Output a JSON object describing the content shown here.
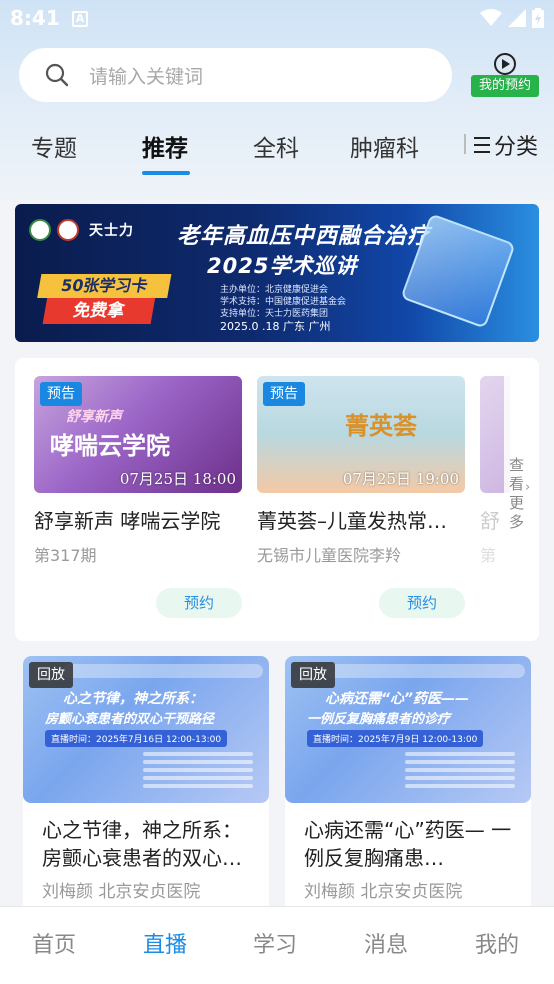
{
  "status_bar": {
    "time": "8:41",
    "notif_icon": "A"
  },
  "search": {
    "placeholder": "请输入关键词"
  },
  "reservation": {
    "label": "我的预约"
  },
  "tabs": [
    {
      "label": "专题"
    },
    {
      "label": "推荐",
      "active": true
    },
    {
      "label": "全科"
    },
    {
      "label": "肿瘤科"
    }
  ],
  "category": {
    "label": "分类"
  },
  "banner": {
    "brand": "天士力",
    "title_line1": "老年高血压中西融合治疗",
    "title_line2": "2025学术巡讲",
    "organizers": [
      "主办单位：北京健康促进会",
      "学术支持：中国健康促进基金会",
      "支持单位：天士力医药集团"
    ],
    "date_place": "2025.0 .18 广东 广州",
    "card_top": "50张学习卡",
    "card_bottom": "免费拿"
  },
  "live": {
    "items": [
      {
        "badge": "预告",
        "thumb_small": "舒享新声",
        "thumb_big": "哮喘云学院",
        "time": "07月25日  18:00",
        "title": "舒享新声  哮喘云学院",
        "subtitle": "第317期",
        "button": "预约"
      },
      {
        "badge": "预告",
        "thumb_big": "菁英荟",
        "time": "07月25日  19:00",
        "title": "菁英荟–儿童发热常见问题",
        "subtitle": "无锡市儿童医院李羚",
        "button": "预约"
      }
    ],
    "partial_title": "舒",
    "partial_sub": "第",
    "more": "查看更多"
  },
  "replays": [
    {
      "badge": "回放",
      "thumb_h1": "心之节律，神之所系：",
      "thumb_h2": "房颤心衰患者的双心干预路径",
      "thumb_date": "直播时间：2025年7月16日 12:00-13:00",
      "title": "心之节律，神之所系：房颤心衰患者的双心…",
      "subtitle": "刘梅颜  北京安贞医院"
    },
    {
      "badge": "回放",
      "thumb_h1": "心病还需“心”药医——",
      "thumb_h2": "一例反复胸痛患者的诊疗",
      "thumb_date": "直播时间：2025年7月9日 12:00-13:00",
      "title": "心病还需“心”药医— 一例反复胸痛患…",
      "subtitle": "刘梅颜  北京安贞医院"
    }
  ],
  "bottom_nav": [
    {
      "label": "首页"
    },
    {
      "label": "直播",
      "active": true
    },
    {
      "label": "学习"
    },
    {
      "label": "消息"
    },
    {
      "label": "我的"
    }
  ],
  "colors": {
    "accent": "#1b8ce3",
    "reservation_green": "#27b24a",
    "badge_blue": "#1a88e0"
  }
}
